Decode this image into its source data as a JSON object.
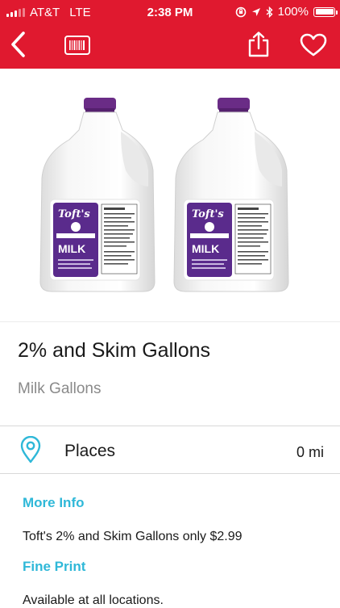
{
  "status_bar": {
    "carrier": "AT&T",
    "network": "LTE",
    "time": "2:38 PM",
    "battery": "100%",
    "battery_level": 1.0
  },
  "nav": {
    "back_icon": "chevron-left-icon",
    "barcode_icon": "barcode-icon",
    "share_icon": "share-icon",
    "favorite_icon": "heart-icon"
  },
  "product": {
    "brand": "Toft's",
    "label": "MILK",
    "title": "2% and Skim Gallons",
    "category": "Milk Gallons"
  },
  "places": {
    "label": "Places",
    "distance": "0 mi",
    "icon": "location-pin-icon"
  },
  "sections": {
    "more_info_heading": "More Info",
    "more_info_text": "Toft's 2% and Skim Gallons only $2.99",
    "fine_print_heading": "Fine Print",
    "fine_print_text": "Available at all locations."
  },
  "colors": {
    "brand_red": "#e0192f",
    "accent_cyan": "#2fb8d8",
    "cap_purple": "#6a2c86"
  }
}
